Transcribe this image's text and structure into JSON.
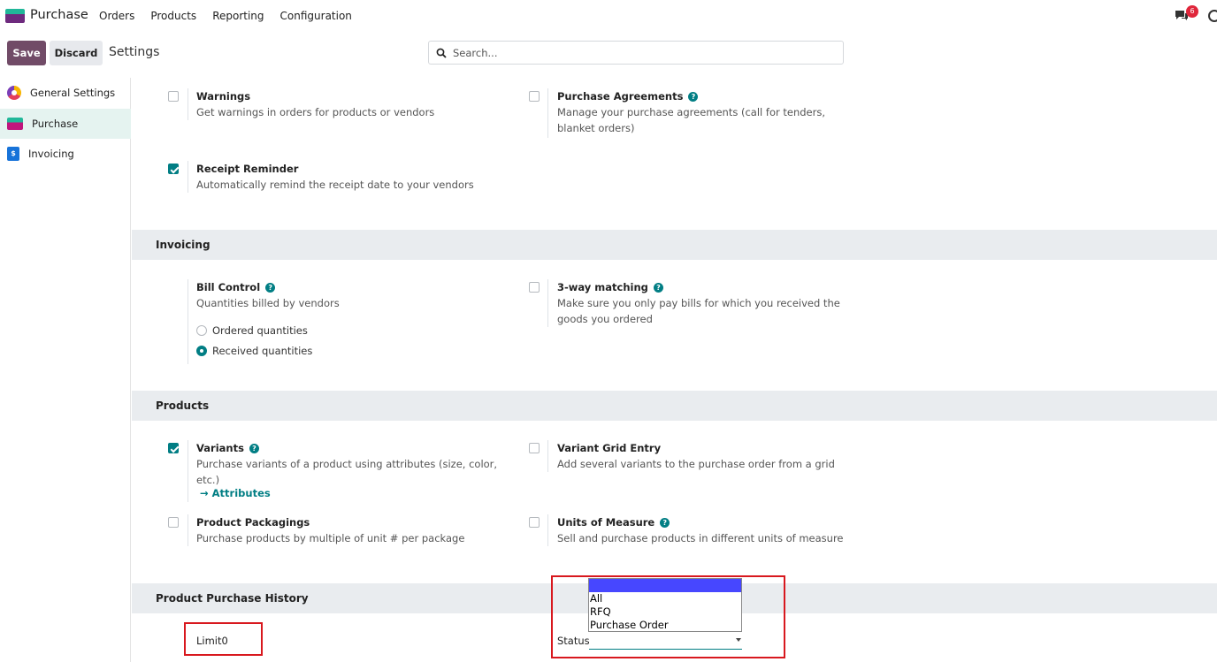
{
  "navbar": {
    "app_name": "Purchase",
    "menu": [
      "Orders",
      "Products",
      "Reporting",
      "Configuration"
    ],
    "chat_badge": "6"
  },
  "control_panel": {
    "save_label": "Save",
    "discard_label": "Discard",
    "breadcrumb": "Settings",
    "search_placeholder": "Search..."
  },
  "sidebar": {
    "items": [
      {
        "label": "General Settings",
        "icon": "general-settings-icon",
        "active": false
      },
      {
        "label": "Purchase",
        "icon": "purchase-app-icon",
        "active": true
      },
      {
        "label": "Invoicing",
        "icon": "invoicing-app-icon",
        "active": false
      }
    ]
  },
  "orders_section": {
    "warnings": {
      "title": "Warnings",
      "desc": "Get warnings in orders for products or vendors",
      "checked": false
    },
    "purchase_agreements": {
      "title": "Purchase Agreements",
      "desc": "Manage your purchase agreements (call for tenders, blanket orders)",
      "checked": false
    },
    "receipt_reminder": {
      "title": "Receipt Reminder",
      "desc": "Automatically remind the receipt date to your vendors",
      "checked": true
    }
  },
  "invoicing_section": {
    "heading": "Invoicing",
    "bill_control": {
      "title": "Bill Control",
      "desc": "Quantities billed by vendors",
      "options": [
        "Ordered quantities",
        "Received quantities"
      ],
      "selected": "Received quantities"
    },
    "three_way_matching": {
      "title": "3-way matching",
      "desc": "Make sure you only pay bills for which you received the goods you ordered",
      "checked": false
    }
  },
  "products_section": {
    "heading": "Products",
    "variants": {
      "title": "Variants",
      "desc": "Purchase variants of a product using attributes (size, color, etc.)",
      "checked": true,
      "link": "Attributes"
    },
    "variant_grid_entry": {
      "title": "Variant Grid Entry",
      "desc": "Add several variants to the purchase order from a grid",
      "checked": false
    },
    "product_packagings": {
      "title": "Product Packagings",
      "desc": "Purchase products by multiple of unit # per package",
      "checked": false
    },
    "units_of_measure": {
      "title": "Units of Measure",
      "desc": "Sell and purchase products in different units of measure",
      "checked": false
    }
  },
  "history_section": {
    "heading": "Product Purchase History",
    "limit_label": "Limit",
    "limit_value": "0",
    "status_label": "Status",
    "status_options": [
      "",
      "All",
      "RFQ",
      "Purchase Order"
    ]
  },
  "colors": {
    "primary": "#714b67",
    "accent": "#017e84",
    "highlight_box": "#d8181e",
    "section_bg": "#e9ecef"
  }
}
